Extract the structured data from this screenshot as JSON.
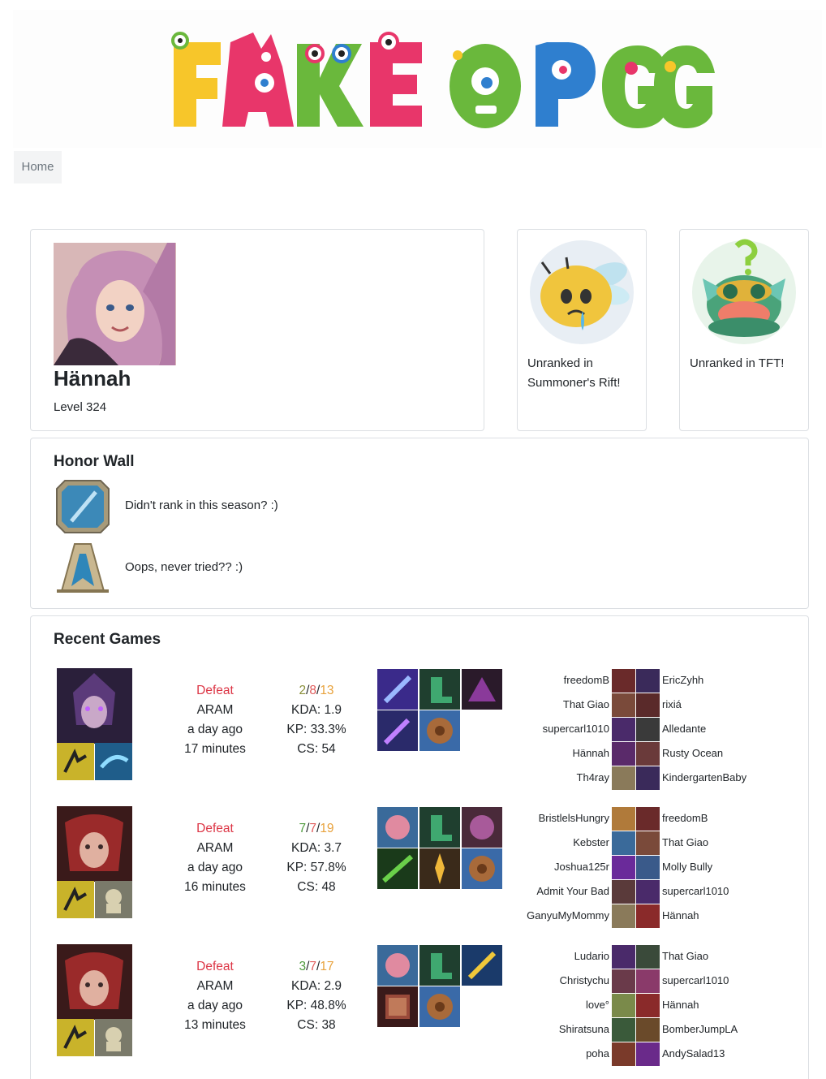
{
  "site": {
    "logo_text": "FAKE OPGG"
  },
  "nav": {
    "home": "Home"
  },
  "profile": {
    "name": "Hännah",
    "level": "Level 324"
  },
  "ranks": {
    "summoners_rift": "Unranked in Summoner's Rift!",
    "tft": "Unranked in TFT!"
  },
  "honor_wall": {
    "title": "Honor Wall",
    "rows": [
      {
        "text": "Didn't rank in this season? :)",
        "icon": "rank-emblem-icon"
      },
      {
        "text": "Oops, never tried?? :)",
        "icon": "honor-emblem-icon"
      }
    ]
  },
  "recent_games": {
    "title": "Recent Games",
    "games": [
      {
        "result": "Defeat",
        "mode": "ARAM",
        "when": "a day ago",
        "duration": "17 minutes",
        "k": "2",
        "d": "8",
        "a": "13",
        "kda": "KDA: 1.9",
        "kp": "KP: 33.3%",
        "cs": "CS: 54",
        "left_team": [
          "freedomB",
          "That Giao",
          "supercarl1010",
          "Hännah",
          "Th4ray"
        ],
        "right_team": [
          "EricZyhh",
          "rixiá",
          "Alledante",
          "Rusty Ocean",
          "KindergartenBaby"
        ]
      },
      {
        "result": "Defeat",
        "mode": "ARAM",
        "when": "a day ago",
        "duration": "16 minutes",
        "k": "7",
        "d": "7",
        "a": "19",
        "kda": "KDA: 3.7",
        "kp": "KP: 57.8%",
        "cs": "CS: 48",
        "left_team": [
          "BristlelsHungry",
          "Kebster",
          "Joshua125r",
          "Admit Your Bad",
          "GanyuMyMommy"
        ],
        "right_team": [
          "freedomB",
          "That Giao",
          "Molly Bully",
          "supercarl1010",
          "Hännah"
        ]
      },
      {
        "result": "Defeat",
        "mode": "ARAM",
        "when": "a day ago",
        "duration": "13 minutes",
        "k": "3",
        "d": "7",
        "a": "17",
        "kda": "KDA: 2.9",
        "kp": "KP: 48.8%",
        "cs": "CS: 38",
        "left_team": [
          "Ludario",
          "Christychu",
          "love°",
          "Shiratsuna",
          "poha"
        ],
        "right_team": [
          "That Giao",
          "supercarl1010",
          "Hännah",
          "BomberJumpLA",
          "AndySalad13"
        ]
      }
    ]
  },
  "colors": {
    "defeat": "#dc3545",
    "logo_yellow": "#f7c62a",
    "logo_pink": "#e8366a",
    "logo_green": "#6ab83c",
    "logo_blue": "#2f7fcf"
  }
}
